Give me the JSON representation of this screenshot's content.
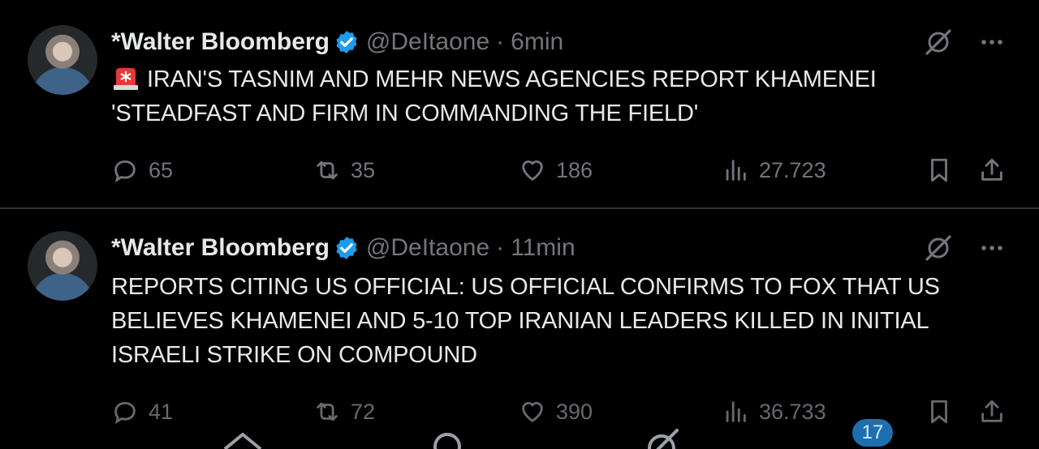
{
  "tweets": [
    {
      "author": "*Walter Bloomberg",
      "handle": "@DeItaone",
      "separator": "·",
      "time": "6min",
      "text": "IRAN'S TASNIM AND MEHR NEWS AGENCIES REPORT KHAMENEI\n'STEADFAST AND FIRM IN COMMANDING THE FIELD'",
      "emoji": "rotating-light",
      "replies": "65",
      "reposts": "35",
      "likes": "186",
      "views": "27.723"
    },
    {
      "author": "*Walter Bloomberg",
      "handle": "@DeItaone",
      "separator": "·",
      "time": "11min",
      "text": "REPORTS CITING US OFFICIAL:  US OFFICIAL CONFIRMS TO FOX THAT US\nBELIEVES KHAMENEI AND 5-10 TOP IRANIAN LEADERS KILLED IN INITIAL\nISRAELI STRIKE ON COMPOUND",
      "replies": "41",
      "reposts": "72",
      "likes": "390",
      "views": "36.733"
    }
  ],
  "bottom_nav": {
    "notification_badge": "17"
  },
  "colors": {
    "background": "#000000",
    "primary_text": "#e7e9ea",
    "secondary_text": "#71767b",
    "verified": "#1d9bf0",
    "divider": "#2f3336"
  }
}
